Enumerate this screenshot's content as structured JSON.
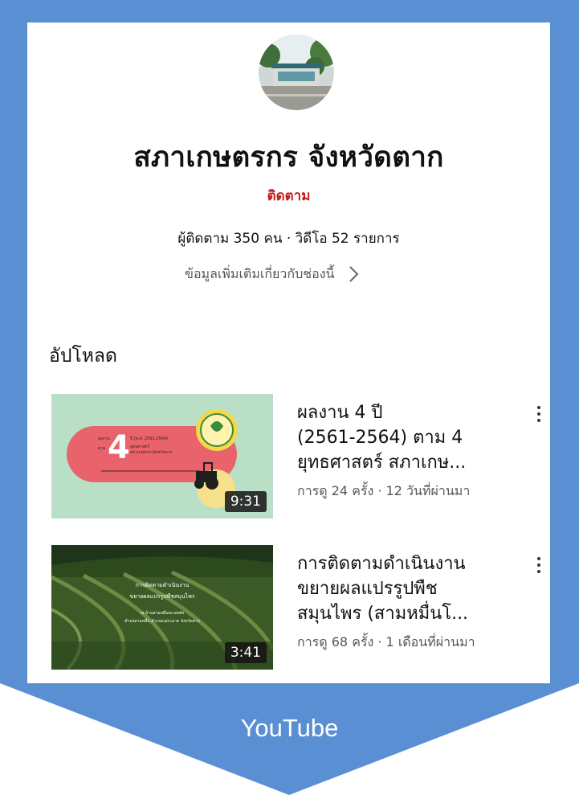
{
  "colors": {
    "frame": "#5b8fd4",
    "follow": "#c41b1b",
    "thumb1_bg": "#b9e0c6",
    "thumb1_ribbon": "#e8636b"
  },
  "channel": {
    "avatar_icon": "channel-avatar-photo",
    "name": "สภาเกษตรกร จังหวัดตาก",
    "follow_label": "ติดตาม",
    "stats": "ผู้ติดตาม 350 คน · วิดีโอ 52 รายการ",
    "more_info": "ข้อมูลเพิ่มเติมเกี่ยวกับช่องนี้"
  },
  "uploads": {
    "heading": "อัปโหลด",
    "videos": [
      {
        "title_l1": "ผลงาน 4 ปี",
        "title_l2": "(2561-2564) ตาม 4",
        "title_l3": "ยุทธศาสตร์ สภาเกษ...",
        "meta": "การดู 24 ครั้ง · 12 วันที่ผ่านมา",
        "duration": "9:31",
        "thumb_big_number": "4",
        "thumb_l1": "ปี (พ.ศ. 2561-2564)",
        "thumb_l2": "ยุทธศาสตร์",
        "thumb_l3": "สภาเกษตรกรจังหวัดตาก",
        "thumb_left_a": "ผลงาน",
        "thumb_left_b": "ตาม"
      },
      {
        "title_l1": "การติดตามดำเนินงาน",
        "title_l2": "ขยายผลแปรรูปพืช",
        "title_l3": "สมุนไพร (สามหมื่นโ...",
        "meta": "การดู 68 ครั้ง · 1 เดือนที่ผ่านมา",
        "duration": "3:41",
        "thumb_l1": "การติดตามดำเนินงาน",
        "thumb_l2": "ขยายผลแปรรูปพืชสมุนไพร",
        "thumb_l3": "ณ บ้านสามหมื่นทะเลพลัง",
        "thumb_l4": "ตำบลสามหมื่น อำเภอแม่ระมาด จังหวัดตาก"
      }
    ]
  },
  "footer": {
    "label": "YouTube"
  }
}
